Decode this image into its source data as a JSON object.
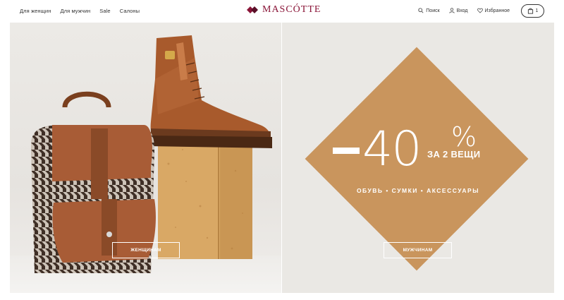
{
  "header": {
    "nav_left": [
      "Для женщин",
      "Для мужчин",
      "Sale",
      "Салоны"
    ],
    "logo_text": "MASCÓTTE",
    "search_label": "Поиск",
    "login_label": "Вход",
    "favorites_label": "Избранное",
    "cart_count": "1"
  },
  "hero": {
    "left_button": "ЖЕНЩИНАМ",
    "right_button": "МУЖЧИНАМ",
    "sale_number": "40",
    "sale_percent": "%",
    "sale_sub": "ЗА 2 ВЕЩИ",
    "sale_categories": "ОБУВЬ • СУМКИ • АКСЕССУАРЫ"
  },
  "colors": {
    "brand": "#8a1538",
    "promo": "#c9955d",
    "background": "#eae8e4"
  },
  "icons": [
    "logo-mark-icon",
    "search-icon",
    "user-icon",
    "heart-icon",
    "bag-icon"
  ]
}
